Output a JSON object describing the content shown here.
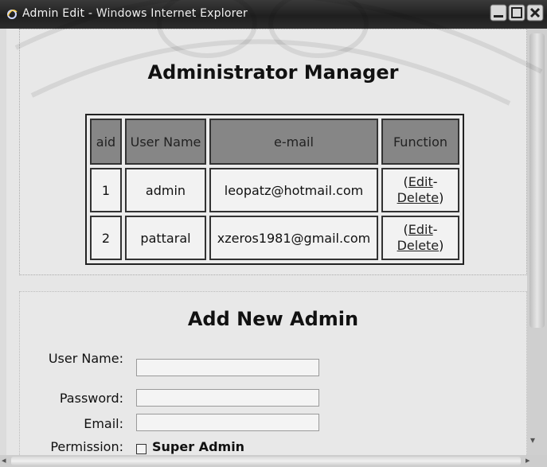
{
  "window": {
    "title": "Admin Edit - Windows Internet Explorer",
    "title_icon": "ie-icon",
    "controls": [
      "minimize-icon",
      "maximize-icon",
      "close-icon"
    ]
  },
  "manager": {
    "heading": "Administrator Manager",
    "columns": [
      "aid",
      "User Name",
      "e-mail",
      "Function"
    ],
    "rows": [
      {
        "aid": "1",
        "username": "admin",
        "email": "leopatz@hotmail.com",
        "open": "(",
        "edit": "Edit",
        "sep": "-",
        "delete": "Delete",
        "close": ")"
      },
      {
        "aid": "2",
        "username": "pattaral",
        "email": "xzeros1981@gmail.com",
        "open": "(",
        "edit": "Edit",
        "sep": "-",
        "delete": "Delete",
        "close": ")"
      }
    ]
  },
  "add_form": {
    "heading": "Add New Admin",
    "username_label": "User Name:",
    "password_label": "Password:",
    "email_label": "Email:",
    "permission_label": "Permission:",
    "super_admin_label": "Super Admin",
    "username_value": "",
    "password_value": "",
    "email_value": "",
    "super_admin_checked": false
  }
}
